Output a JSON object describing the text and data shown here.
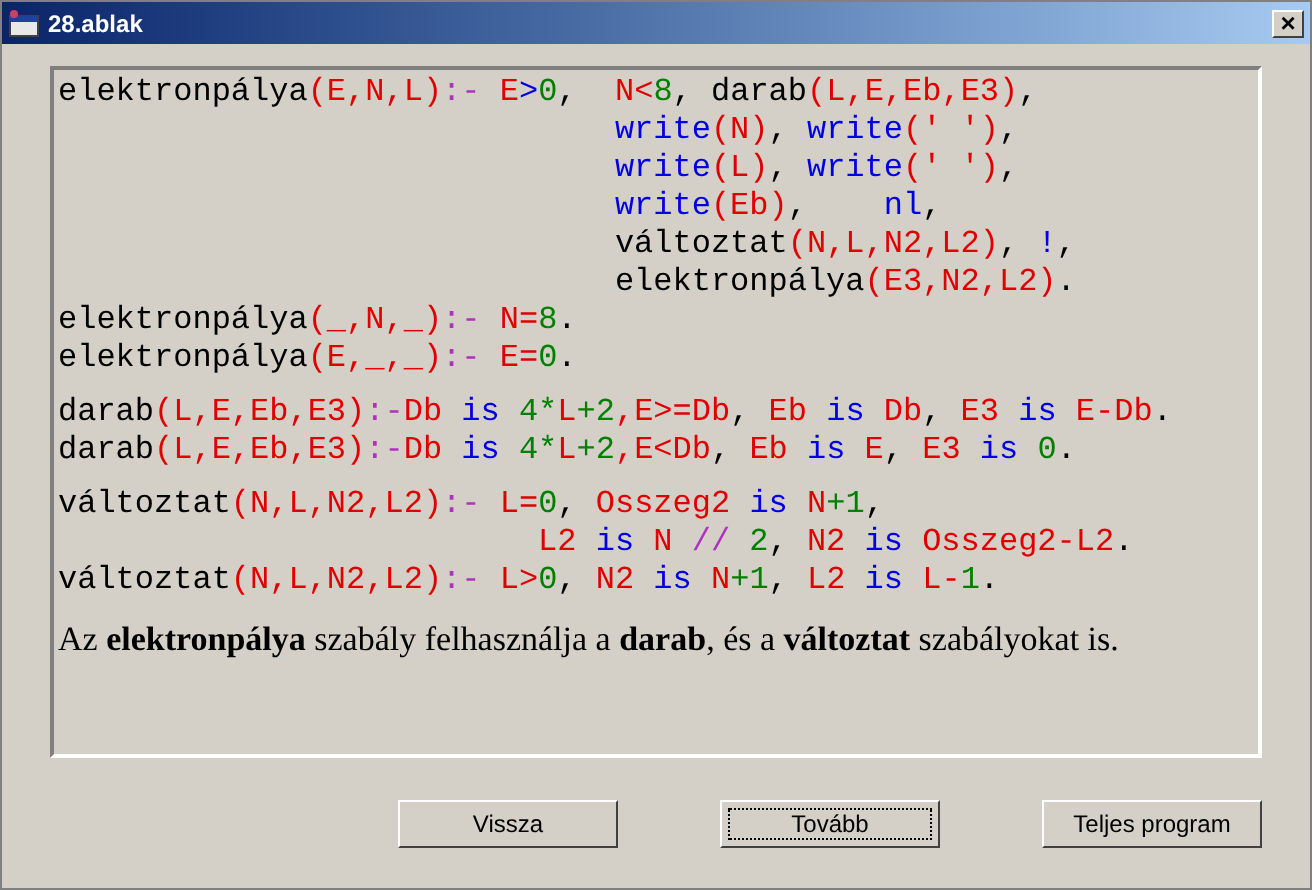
{
  "window": {
    "title": "28.ablak",
    "close": "×"
  },
  "code_groups": [
    [
      {
        "kind": "head",
        "segments": [
          {
            "kind": "t",
            "text": "elektronpálya"
          },
          {
            "kind": "v",
            "text": "(E,N,L)"
          },
          {
            "kind": "o",
            "text": ":-"
          },
          {
            "kind": "v",
            "text": " E"
          },
          {
            "kind": "k",
            "text": ">"
          },
          {
            "kind": "n",
            "text": "0"
          },
          {
            "kind": "t",
            "text": ", "
          },
          {
            "kind": "v",
            "text": " N<"
          },
          {
            "kind": "n",
            "text": "8"
          },
          {
            "kind": "t",
            "text": ", darab"
          },
          {
            "kind": "v",
            "text": "(L,E,Eb,E3)"
          },
          {
            "kind": "t",
            "text": ","
          }
        ]
      },
      {
        "kind": "body",
        "segments": [
          {
            "kind": "k",
            "text": "write"
          },
          {
            "kind": "v",
            "text": "(N)"
          },
          {
            "kind": "t",
            "text": ", "
          },
          {
            "kind": "k",
            "text": "write"
          },
          {
            "kind": "v",
            "text": "(' ')"
          },
          {
            "kind": "t",
            "text": ","
          }
        ]
      },
      {
        "kind": "body",
        "segments": [
          {
            "kind": "k",
            "text": "write"
          },
          {
            "kind": "v",
            "text": "(L)"
          },
          {
            "kind": "t",
            "text": ", "
          },
          {
            "kind": "k",
            "text": "write"
          },
          {
            "kind": "v",
            "text": "(' ')"
          },
          {
            "kind": "t",
            "text": ","
          }
        ]
      },
      {
        "kind": "body",
        "segments": [
          {
            "kind": "k",
            "text": "write"
          },
          {
            "kind": "v",
            "text": "(Eb)"
          },
          {
            "kind": "t",
            "text": ",    "
          },
          {
            "kind": "k",
            "text": "nl"
          },
          {
            "kind": "t",
            "text": ","
          }
        ]
      },
      {
        "kind": "body",
        "segments": [
          {
            "kind": "t",
            "text": "változtat"
          },
          {
            "kind": "v",
            "text": "(N,L,N2,L2)"
          },
          {
            "kind": "t",
            "text": ", "
          },
          {
            "kind": "k",
            "text": "!"
          },
          {
            "kind": "t",
            "text": ","
          }
        ]
      },
      {
        "kind": "body",
        "segments": [
          {
            "kind": "t",
            "text": "elektronpálya"
          },
          {
            "kind": "v",
            "text": "(E3,N2,L2)"
          },
          {
            "kind": "t",
            "text": "."
          }
        ]
      },
      {
        "kind": "head",
        "segments": [
          {
            "kind": "t",
            "text": "elektronpálya"
          },
          {
            "kind": "v",
            "text": "(_,N,_)"
          },
          {
            "kind": "o",
            "text": ":-"
          },
          {
            "kind": "v",
            "text": " N="
          },
          {
            "kind": "n",
            "text": "8"
          },
          {
            "kind": "t",
            "text": "."
          }
        ]
      },
      {
        "kind": "head",
        "segments": [
          {
            "kind": "t",
            "text": "elektronpálya"
          },
          {
            "kind": "v",
            "text": "(E,_,_)"
          },
          {
            "kind": "o",
            "text": ":-"
          },
          {
            "kind": "v",
            "text": " E="
          },
          {
            "kind": "n",
            "text": "0"
          },
          {
            "kind": "t",
            "text": "."
          }
        ]
      }
    ],
    [
      {
        "kind": "head",
        "segments": [
          {
            "kind": "t",
            "text": "darab"
          },
          {
            "kind": "v",
            "text": "(L,E,Eb,E3)"
          },
          {
            "kind": "o",
            "text": ":-"
          },
          {
            "kind": "v",
            "text": "Db"
          },
          {
            "kind": "k",
            "text": " is "
          },
          {
            "kind": "n",
            "text": "4*"
          },
          {
            "kind": "v",
            "text": "L"
          },
          {
            "kind": "n",
            "text": "+2"
          },
          {
            "kind": "v",
            "text": ",E>=Db"
          },
          {
            "kind": "t",
            "text": ", "
          },
          {
            "kind": "v",
            "text": "Eb"
          },
          {
            "kind": "k",
            "text": " is "
          },
          {
            "kind": "v",
            "text": "Db"
          },
          {
            "kind": "t",
            "text": ", "
          },
          {
            "kind": "v",
            "text": "E3"
          },
          {
            "kind": "k",
            "text": " is "
          },
          {
            "kind": "v",
            "text": "E-Db"
          },
          {
            "kind": "t",
            "text": "."
          }
        ]
      },
      {
        "kind": "head",
        "segments": [
          {
            "kind": "t",
            "text": "darab"
          },
          {
            "kind": "v",
            "text": "(L,E,Eb,E3)"
          },
          {
            "kind": "o",
            "text": ":-"
          },
          {
            "kind": "v",
            "text": "Db"
          },
          {
            "kind": "k",
            "text": " is "
          },
          {
            "kind": "n",
            "text": "4*"
          },
          {
            "kind": "v",
            "text": "L"
          },
          {
            "kind": "n",
            "text": "+2"
          },
          {
            "kind": "v",
            "text": ",E<Db"
          },
          {
            "kind": "t",
            "text": ", "
          },
          {
            "kind": "v",
            "text": "Eb"
          },
          {
            "kind": "k",
            "text": " is "
          },
          {
            "kind": "v",
            "text": "E"
          },
          {
            "kind": "t",
            "text": ", "
          },
          {
            "kind": "v",
            "text": "E3"
          },
          {
            "kind": "k",
            "text": " is "
          },
          {
            "kind": "n",
            "text": "0"
          },
          {
            "kind": "t",
            "text": "."
          }
        ]
      }
    ],
    [
      {
        "kind": "head",
        "segments": [
          {
            "kind": "t",
            "text": "változtat"
          },
          {
            "kind": "v",
            "text": "(N,L,N2,L2)"
          },
          {
            "kind": "o",
            "text": ":-"
          },
          {
            "kind": "v",
            "text": " L="
          },
          {
            "kind": "n",
            "text": "0"
          },
          {
            "kind": "t",
            "text": ", "
          },
          {
            "kind": "v",
            "text": "Osszeg2"
          },
          {
            "kind": "k",
            "text": " is "
          },
          {
            "kind": "v",
            "text": "N"
          },
          {
            "kind": "n",
            "text": "+1"
          },
          {
            "kind": "t",
            "text": ","
          }
        ]
      },
      {
        "kind": "wrap",
        "segments": [
          {
            "kind": "v",
            "text": "L2"
          },
          {
            "kind": "k",
            "text": " is "
          },
          {
            "kind": "v",
            "text": "N "
          },
          {
            "kind": "o",
            "text": "//"
          },
          {
            "kind": "n",
            "text": " 2"
          },
          {
            "kind": "t",
            "text": ", "
          },
          {
            "kind": "v",
            "text": "N2"
          },
          {
            "kind": "k",
            "text": " is "
          },
          {
            "kind": "v",
            "text": "Osszeg2-L2"
          },
          {
            "kind": "t",
            "text": "."
          }
        ]
      },
      {
        "kind": "head",
        "segments": [
          {
            "kind": "t",
            "text": "változtat"
          },
          {
            "kind": "v",
            "text": "(N,L,N2,L2)"
          },
          {
            "kind": "o",
            "text": ":-"
          },
          {
            "kind": "v",
            "text": " L>"
          },
          {
            "kind": "n",
            "text": "0"
          },
          {
            "kind": "t",
            "text": ", "
          },
          {
            "kind": "v",
            "text": "N2"
          },
          {
            "kind": "k",
            "text": " is "
          },
          {
            "kind": "v",
            "text": "N"
          },
          {
            "kind": "n",
            "text": "+1"
          },
          {
            "kind": "t",
            "text": ", "
          },
          {
            "kind": "v",
            "text": "L2"
          },
          {
            "kind": "k",
            "text": " is "
          },
          {
            "kind": "v",
            "text": "L-"
          },
          {
            "kind": "n",
            "text": "1"
          },
          {
            "kind": "t",
            "text": "."
          }
        ]
      }
    ]
  ],
  "note": "Az **elektronpálya** szabály felhasználja a **darab**, és a **változtat** szabályokat is.",
  "buttons": [
    {
      "label": "Vissza",
      "focused": false
    },
    {
      "label": "Tovább",
      "focused": true
    },
    {
      "label": "Teljes program",
      "focused": false
    }
  ]
}
